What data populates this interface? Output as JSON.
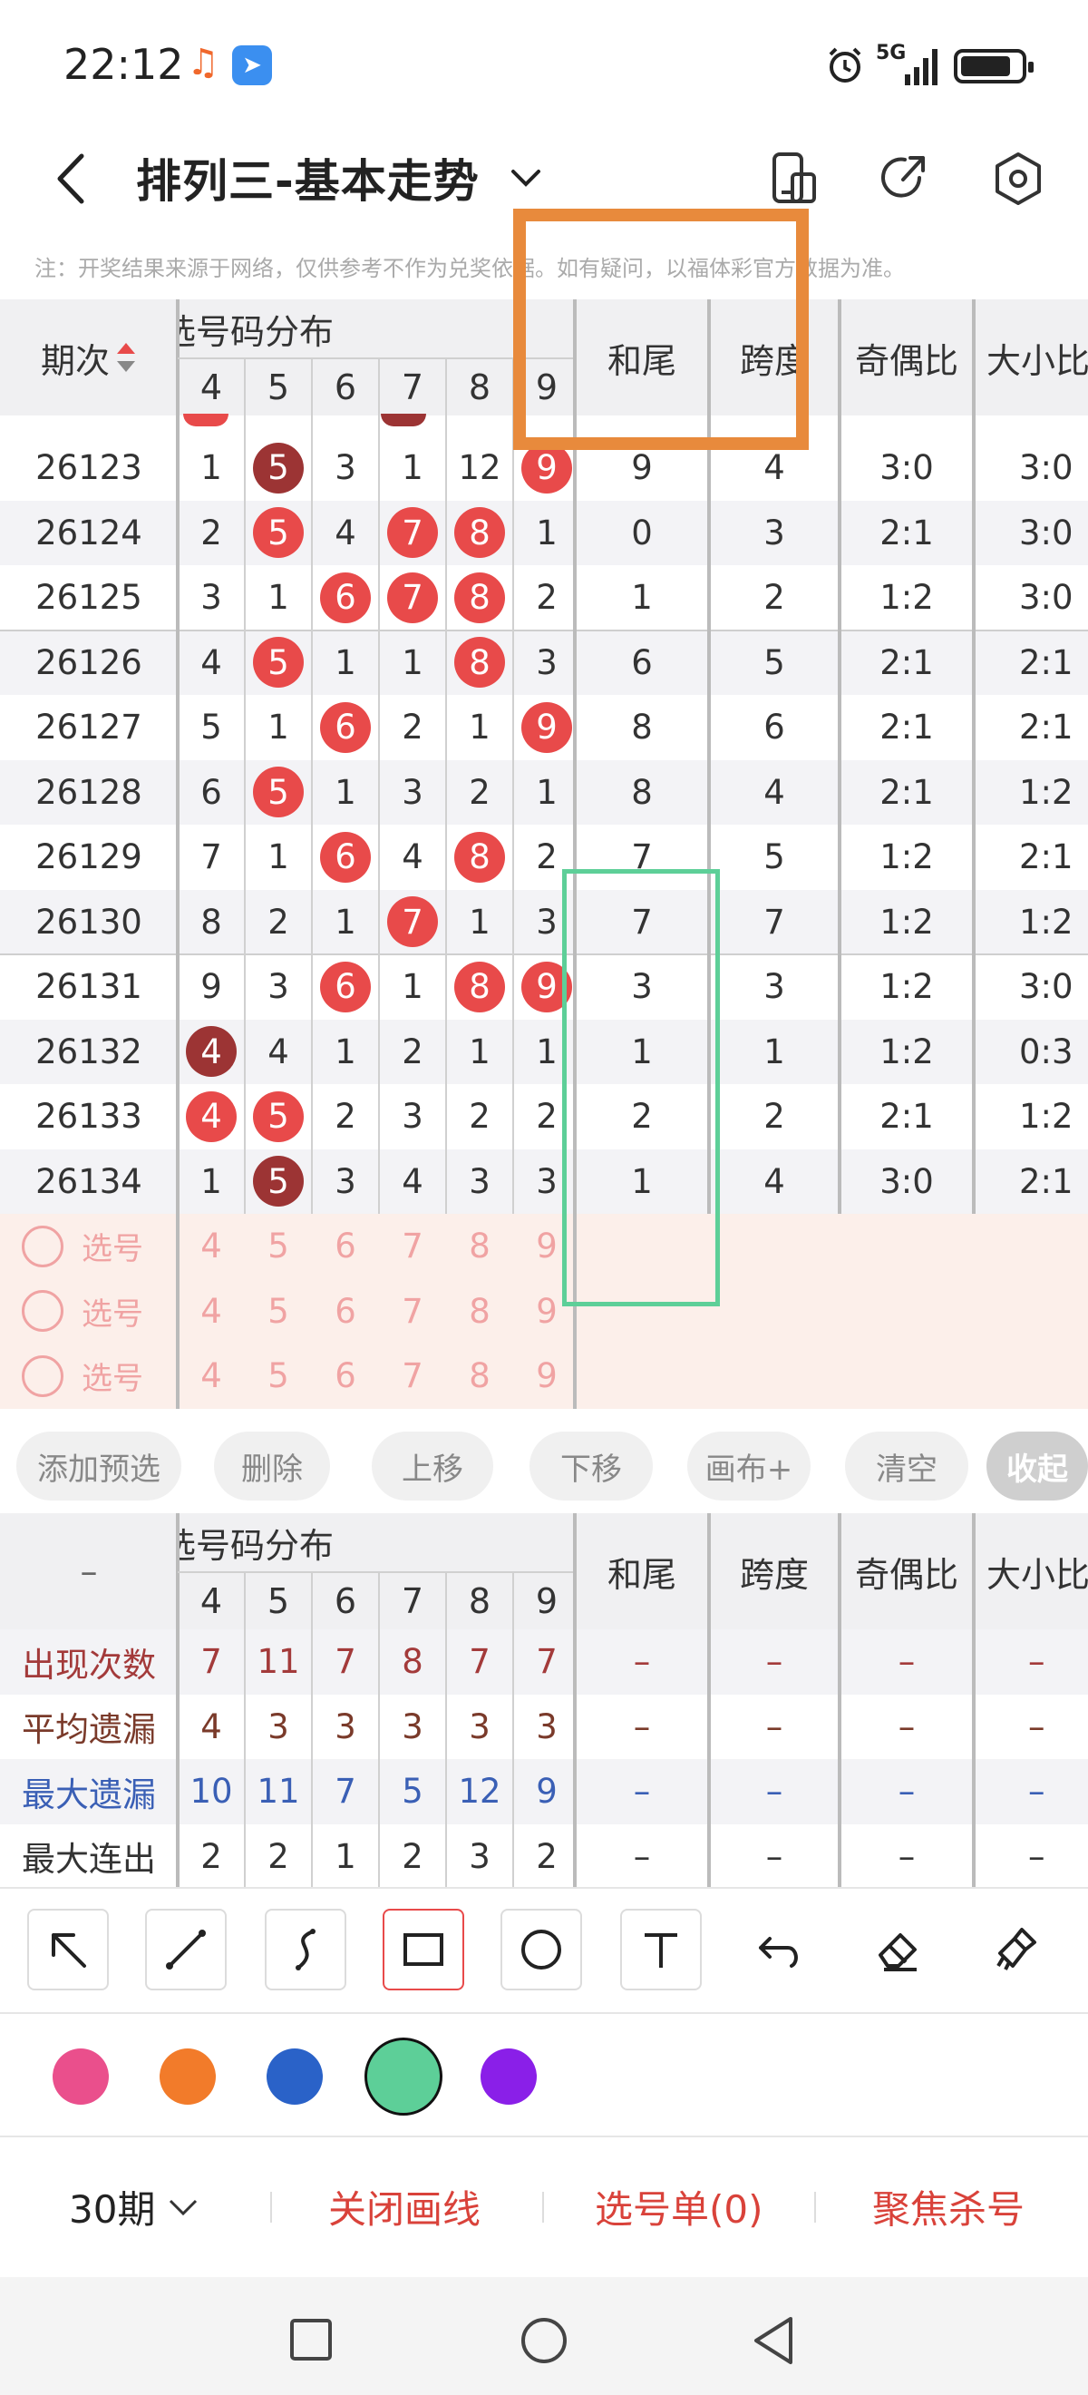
{
  "status_bar": {
    "time": "22:12",
    "network": "5G",
    "battery_level": 0.85
  },
  "header": {
    "title": "排列三-基本走势"
  },
  "note": "注：开奖结果来源于网络，仅供参考不作为兑奖依据。如有疑问，以福体彩官方数据为准。",
  "table": {
    "period_header": "期次",
    "dist_header": "选号码分布",
    "digits": [
      "4",
      "5",
      "6",
      "7",
      "8",
      "9"
    ],
    "extra_headers": [
      "和尾",
      "跨度",
      "奇偶比",
      "大小比"
    ],
    "rows": [
      {
        "period": "26123",
        "d": [
          {
            "v": "1"
          },
          {
            "v": "5",
            "b": "dark"
          },
          {
            "v": "3"
          },
          {
            "v": "1"
          },
          {
            "v": "12"
          },
          {
            "v": "9",
            "b": "red"
          }
        ],
        "hw": "9",
        "kd": "4",
        "jo": "3:0",
        "dx": "3:0"
      },
      {
        "period": "26124",
        "d": [
          {
            "v": "2"
          },
          {
            "v": "5",
            "b": "red"
          },
          {
            "v": "4"
          },
          {
            "v": "7",
            "b": "red"
          },
          {
            "v": "8",
            "b": "red"
          },
          {
            "v": "1"
          }
        ],
        "hw": "0",
        "kd": "3",
        "jo": "2:1",
        "dx": "3:0"
      },
      {
        "period": "26125",
        "d": [
          {
            "v": "3"
          },
          {
            "v": "1"
          },
          {
            "v": "6",
            "b": "red"
          },
          {
            "v": "7",
            "b": "red"
          },
          {
            "v": "8",
            "b": "red"
          },
          {
            "v": "2"
          }
        ],
        "hw": "1",
        "kd": "2",
        "jo": "1:2",
        "dx": "3:0"
      },
      {
        "period": "26126",
        "d": [
          {
            "v": "4"
          },
          {
            "v": "5",
            "b": "red"
          },
          {
            "v": "1"
          },
          {
            "v": "1"
          },
          {
            "v": "8",
            "b": "red"
          },
          {
            "v": "3"
          }
        ],
        "hw": "6",
        "kd": "5",
        "jo": "2:1",
        "dx": "2:1"
      },
      {
        "period": "26127",
        "d": [
          {
            "v": "5"
          },
          {
            "v": "1"
          },
          {
            "v": "6",
            "b": "red"
          },
          {
            "v": "2"
          },
          {
            "v": "1"
          },
          {
            "v": "9",
            "b": "red"
          }
        ],
        "hw": "8",
        "kd": "6",
        "jo": "2:1",
        "dx": "2:1"
      },
      {
        "period": "26128",
        "d": [
          {
            "v": "6"
          },
          {
            "v": "5",
            "b": "red"
          },
          {
            "v": "1"
          },
          {
            "v": "3"
          },
          {
            "v": "2"
          },
          {
            "v": "1"
          }
        ],
        "hw": "8",
        "kd": "4",
        "jo": "2:1",
        "dx": "1:2"
      },
      {
        "period": "26129",
        "d": [
          {
            "v": "7"
          },
          {
            "v": "1"
          },
          {
            "v": "6",
            "b": "red"
          },
          {
            "v": "4"
          },
          {
            "v": "8",
            "b": "red"
          },
          {
            "v": "2"
          }
        ],
        "hw": "7",
        "kd": "5",
        "jo": "1:2",
        "dx": "2:1"
      },
      {
        "period": "26130",
        "d": [
          {
            "v": "8"
          },
          {
            "v": "2"
          },
          {
            "v": "1"
          },
          {
            "v": "7",
            "b": "red"
          },
          {
            "v": "1"
          },
          {
            "v": "3"
          }
        ],
        "hw": "7",
        "kd": "7",
        "jo": "1:2",
        "dx": "1:2"
      },
      {
        "period": "26131",
        "d": [
          {
            "v": "9"
          },
          {
            "v": "3"
          },
          {
            "v": "6",
            "b": "red"
          },
          {
            "v": "1"
          },
          {
            "v": "8",
            "b": "red"
          },
          {
            "v": "9",
            "b": "red"
          }
        ],
        "hw": "3",
        "kd": "3",
        "jo": "1:2",
        "dx": "3:0"
      },
      {
        "period": "26132",
        "d": [
          {
            "v": "4",
            "b": "dark"
          },
          {
            "v": "4"
          },
          {
            "v": "1"
          },
          {
            "v": "2"
          },
          {
            "v": "1"
          },
          {
            "v": "1"
          }
        ],
        "hw": "1",
        "kd": "1",
        "jo": "1:2",
        "dx": "0:3"
      },
      {
        "period": "26133",
        "d": [
          {
            "v": "4",
            "b": "red"
          },
          {
            "v": "5",
            "b": "red"
          },
          {
            "v": "2"
          },
          {
            "v": "3"
          },
          {
            "v": "2"
          },
          {
            "v": "2"
          }
        ],
        "hw": "2",
        "kd": "2",
        "jo": "2:1",
        "dx": "1:2"
      },
      {
        "period": "26134",
        "d": [
          {
            "v": "1"
          },
          {
            "v": "5",
            "b": "dark"
          },
          {
            "v": "3"
          },
          {
            "v": "4"
          },
          {
            "v": "3"
          },
          {
            "v": "3"
          }
        ],
        "hw": "1",
        "kd": "4",
        "jo": "3:0",
        "dx": "2:1"
      }
    ],
    "pick_label": "选号",
    "pick_rows": 3
  },
  "actions": [
    "添加预选",
    "删除",
    "上移",
    "下移",
    "画布+",
    "清空",
    "收起"
  ],
  "stats": {
    "dash": "–",
    "rows": [
      {
        "label": "出现次数",
        "color": "#a33a3a",
        "values": [
          "7",
          "11",
          "7",
          "8",
          "7",
          "7"
        ]
      },
      {
        "label": "平均遗漏",
        "color": "#7a3a2a",
        "values": [
          "4",
          "3",
          "3",
          "3",
          "3",
          "3"
        ]
      },
      {
        "label": "最大遗漏",
        "color": "#3a5fb5",
        "values": [
          "10",
          "11",
          "7",
          "5",
          "12",
          "9"
        ]
      },
      {
        "label": "最大连出",
        "color": "#333333",
        "values": [
          "2",
          "2",
          "1",
          "2",
          "3",
          "2"
        ]
      }
    ]
  },
  "tools": [
    "arrow-tool-icon",
    "line-tool-icon",
    "curve-tool-icon",
    "rectangle-tool-icon",
    "circle-tool-icon",
    "text-tool-icon",
    "undo-icon",
    "eraser-icon",
    "clear-brush-icon"
  ],
  "palette": [
    {
      "name": "pink",
      "hex": "#ea4f8c"
    },
    {
      "name": "orange",
      "hex": "#f27b2a"
    },
    {
      "name": "blue",
      "hex": "#2a62c8"
    },
    {
      "name": "green",
      "hex": "#5dcf98"
    },
    {
      "name": "purple",
      "hex": "#8a1fe8"
    }
  ],
  "selected_color": "green",
  "bottom_bar": {
    "periods": "30期",
    "close_lines": "关闭画线",
    "pick_list": "选号单(0)",
    "focus_kill": "聚焦杀号"
  },
  "annotations": [
    {
      "shape": "rectangle",
      "color": "#e88a3c"
    },
    {
      "shape": "rectangle",
      "color": "#5dcf98"
    }
  ]
}
